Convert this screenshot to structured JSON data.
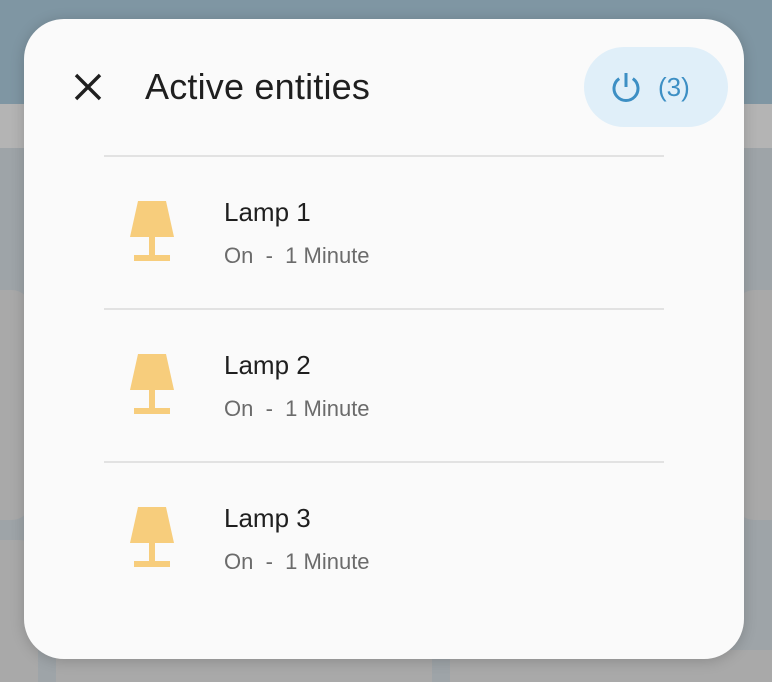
{
  "dialog": {
    "title": "Active entities",
    "close_icon": "close-icon",
    "count_chip": {
      "icon": "power-icon",
      "label": "(3)",
      "color": "#3d8fc4",
      "background": "#e0eff9"
    }
  },
  "entities": [
    {
      "name": "Lamp 1",
      "state": "On",
      "separator": "-",
      "duration": "1 Minute",
      "icon": "lamp-icon",
      "icon_color": "#f7cd7c"
    },
    {
      "name": "Lamp 2",
      "state": "On",
      "separator": "-",
      "duration": "1 Minute",
      "icon": "lamp-icon",
      "icon_color": "#f7cd7c"
    },
    {
      "name": "Lamp 3",
      "state": "On",
      "separator": "-",
      "duration": "1 Minute",
      "icon": "lamp-icon",
      "icon_color": "#f7cd7c"
    }
  ]
}
